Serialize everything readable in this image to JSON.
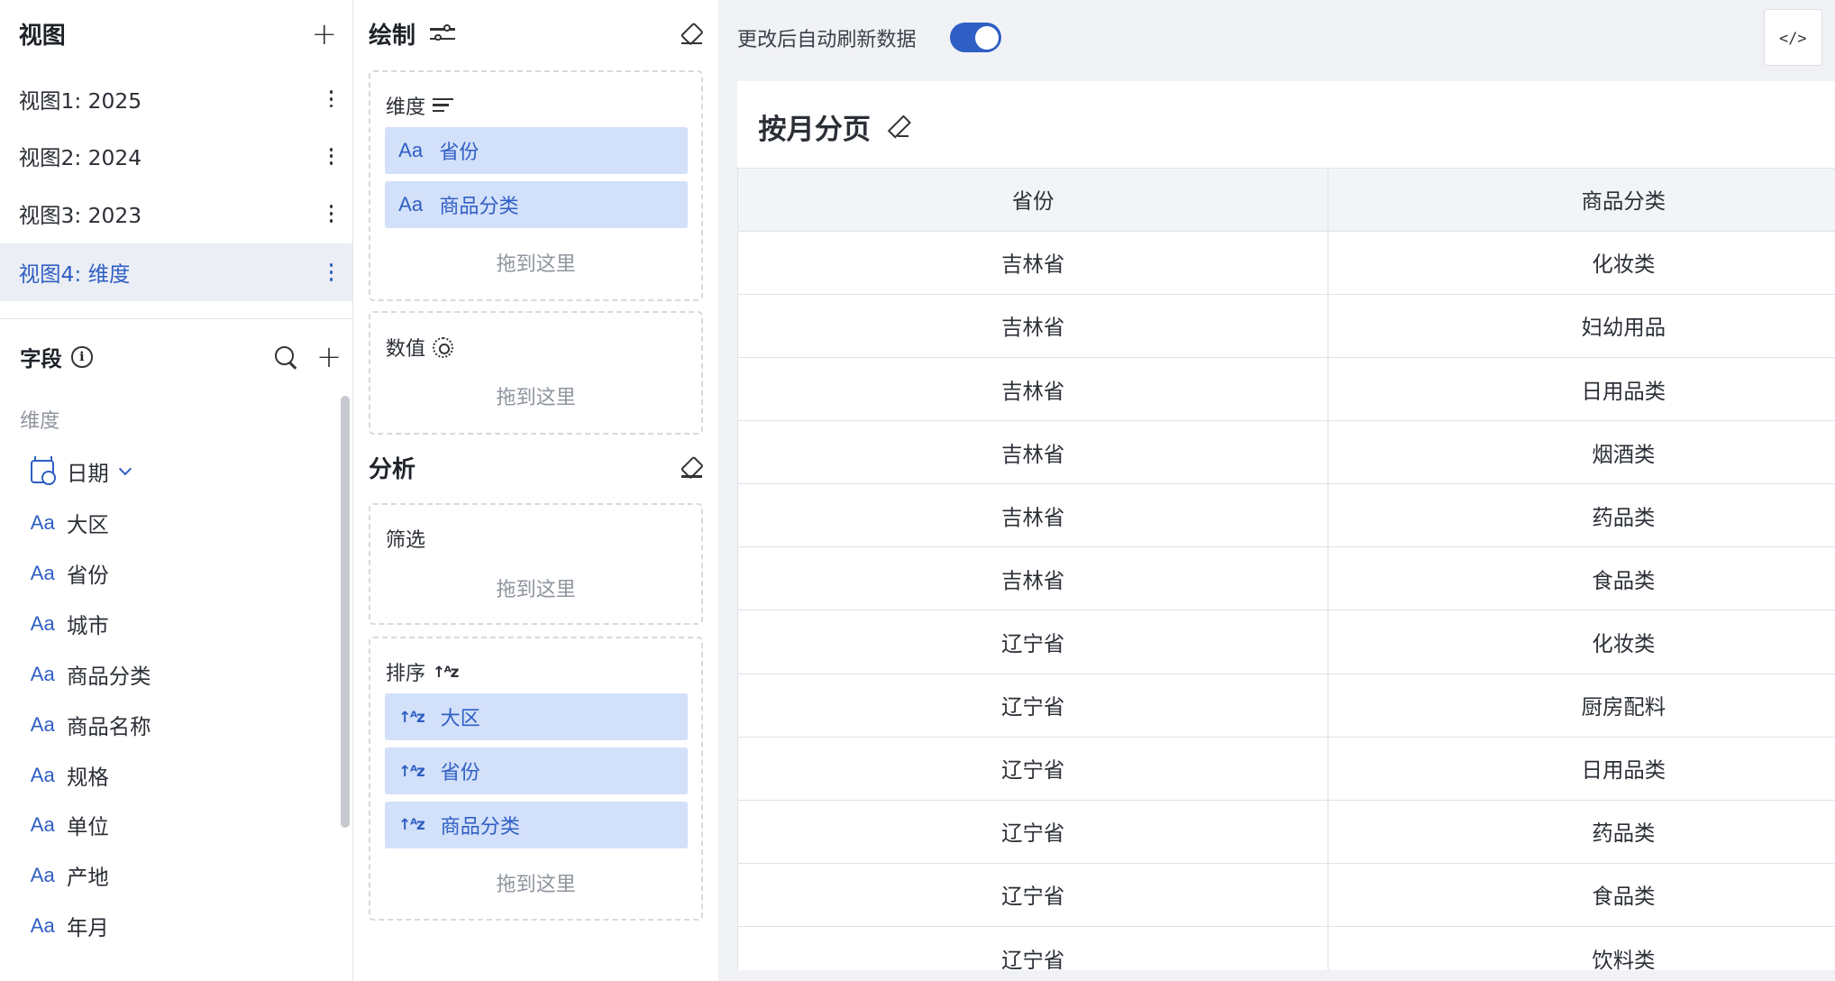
{
  "views": {
    "title": "视图",
    "items": [
      {
        "label": "视图1: 2025"
      },
      {
        "label": "视图2: 2024"
      },
      {
        "label": "视图3: 2023"
      },
      {
        "label": "视图4: 维度",
        "active": true
      }
    ]
  },
  "fields": {
    "title": "字段",
    "group_label": "维度",
    "items": [
      "日期",
      "大区",
      "省份",
      "城市",
      "商品分类",
      "商品名称",
      "规格",
      "单位",
      "产地",
      "年月"
    ],
    "type_glyph": "Aa"
  },
  "draw": {
    "title": "绘制",
    "dimensions_label": "维度",
    "dimensions_chips": [
      "省份",
      "商品分类"
    ],
    "values_label": "数值",
    "drop_hint": "拖到这里"
  },
  "analysis": {
    "title": "分析",
    "filter_label": "筛选",
    "sort_label": "排序",
    "sort_chips": [
      "大区",
      "省份",
      "商品分类"
    ]
  },
  "toolbar": {
    "auto_refresh_label": "更改后自动刷新数据",
    "auto_refresh_on": true,
    "code_button": "</>"
  },
  "table": {
    "title": "按月分页",
    "columns": [
      "省份",
      "商品分类"
    ],
    "rows": [
      [
        "吉林省",
        "化妆类"
      ],
      [
        "吉林省",
        "妇幼用品"
      ],
      [
        "吉林省",
        "日用品类"
      ],
      [
        "吉林省",
        "烟酒类"
      ],
      [
        "吉林省",
        "药品类"
      ],
      [
        "吉林省",
        "食品类"
      ],
      [
        "辽宁省",
        "化妆类"
      ],
      [
        "辽宁省",
        "厨房配料"
      ],
      [
        "辽宁省",
        "日用品类"
      ],
      [
        "辽宁省",
        "药品类"
      ],
      [
        "辽宁省",
        "食品类"
      ],
      [
        "辽宁省",
        "饮料类"
      ]
    ]
  },
  "colors": {
    "accent": "#2f5fc4",
    "chip_bg": "#d3e0fa",
    "active_row_bg": "#ebeef5",
    "canvas_bg": "#f1f2f6"
  }
}
